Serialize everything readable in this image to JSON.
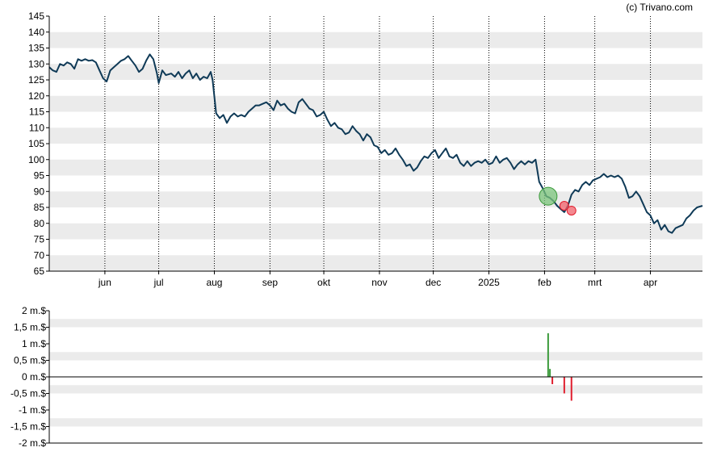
{
  "credit": "(c) Trivano.com",
  "colors": {
    "line": "#0f3a57",
    "band": "#ebebeb",
    "buy": "#3a9a3a",
    "sell": "#e01e2e",
    "buy_fill": "#7bc47b",
    "sell_fill": "#f0606a"
  },
  "chart_data": [
    {
      "type": "line",
      "name": "price",
      "ylim": [
        65,
        145
      ],
      "y_ticks": [
        65,
        70,
        75,
        80,
        85,
        90,
        95,
        100,
        105,
        110,
        115,
        120,
        125,
        130,
        135,
        140,
        145
      ],
      "grid": "alternating horizontal bands, dotted vertical month lines",
      "x_domain": [
        "2024-05-01",
        "2025-04-30"
      ],
      "x_ticks": [
        {
          "label": "jun",
          "date": "2024-06-01"
        },
        {
          "label": "jul",
          "date": "2024-07-01"
        },
        {
          "label": "aug",
          "date": "2024-08-01"
        },
        {
          "label": "sep",
          "date": "2024-09-01"
        },
        {
          "label": "okt",
          "date": "2024-10-01"
        },
        {
          "label": "nov",
          "date": "2024-11-01"
        },
        {
          "label": "dec",
          "date": "2024-12-01"
        },
        {
          "label": "2025",
          "date": "2025-01-01"
        },
        {
          "label": "feb",
          "date": "2025-02-01"
        },
        {
          "label": "mrt",
          "date": "2025-03-01"
        },
        {
          "label": "apr",
          "date": "2025-04-01"
        }
      ],
      "series": [
        {
          "points": [
            [
              "2024-05-01",
              129
            ],
            [
              "2024-05-03",
              128
            ],
            [
              "2024-05-05",
              127.5
            ],
            [
              "2024-05-07",
              130
            ],
            [
              "2024-05-09",
              129.5
            ],
            [
              "2024-05-11",
              130.5
            ],
            [
              "2024-05-13",
              130
            ],
            [
              "2024-05-15",
              128.5
            ],
            [
              "2024-05-17",
              131.5
            ],
            [
              "2024-05-19",
              131
            ],
            [
              "2024-05-21",
              131.5
            ],
            [
              "2024-05-23",
              131
            ],
            [
              "2024-05-25",
              131.2
            ],
            [
              "2024-05-27",
              130.5
            ],
            [
              "2024-05-29",
              128
            ],
            [
              "2024-05-31",
              125.5
            ],
            [
              "2024-06-02",
              124.5
            ],
            [
              "2024-06-04",
              128
            ],
            [
              "2024-06-06",
              129
            ],
            [
              "2024-06-08",
              130
            ],
            [
              "2024-06-10",
              131
            ],
            [
              "2024-06-12",
              131.5
            ],
            [
              "2024-06-14",
              132.5
            ],
            [
              "2024-06-16",
              131
            ],
            [
              "2024-06-18",
              129.5
            ],
            [
              "2024-06-20",
              127.5
            ],
            [
              "2024-06-22",
              128.5
            ],
            [
              "2024-06-24",
              131
            ],
            [
              "2024-06-26",
              133
            ],
            [
              "2024-06-28",
              131.5
            ],
            [
              "2024-06-30",
              127
            ],
            [
              "2024-07-01",
              124
            ],
            [
              "2024-07-03",
              128
            ],
            [
              "2024-07-05",
              126.5
            ],
            [
              "2024-07-08",
              127
            ],
            [
              "2024-07-10",
              126
            ],
            [
              "2024-07-12",
              127.5
            ],
            [
              "2024-07-14",
              125.5
            ],
            [
              "2024-07-16",
              127
            ],
            [
              "2024-07-18",
              128
            ],
            [
              "2024-07-20",
              125.5
            ],
            [
              "2024-07-22",
              127
            ],
            [
              "2024-07-24",
              125
            ],
            [
              "2024-07-26",
              126
            ],
            [
              "2024-07-28",
              125.5
            ],
            [
              "2024-07-30",
              127.5
            ],
            [
              "2024-07-31",
              125
            ],
            [
              "2024-08-02",
              114.5
            ],
            [
              "2024-08-04",
              113
            ],
            [
              "2024-08-06",
              114
            ],
            [
              "2024-08-08",
              111.5
            ],
            [
              "2024-08-10",
              113.5
            ],
            [
              "2024-08-12",
              114.5
            ],
            [
              "2024-08-14",
              113.5
            ],
            [
              "2024-08-16",
              114
            ],
            [
              "2024-08-18",
              113.5
            ],
            [
              "2024-08-20",
              115
            ],
            [
              "2024-08-22",
              116
            ],
            [
              "2024-08-24",
              117
            ],
            [
              "2024-08-26",
              117
            ],
            [
              "2024-08-28",
              117.5
            ],
            [
              "2024-08-30",
              118
            ],
            [
              "2024-09-01",
              117
            ],
            [
              "2024-09-03",
              115.5
            ],
            [
              "2024-09-05",
              118.5
            ],
            [
              "2024-09-07",
              117
            ],
            [
              "2024-09-09",
              117.5
            ],
            [
              "2024-09-11",
              116
            ],
            [
              "2024-09-13",
              115
            ],
            [
              "2024-09-15",
              114.5
            ],
            [
              "2024-09-17",
              118
            ],
            [
              "2024-09-19",
              119
            ],
            [
              "2024-09-21",
              117.5
            ],
            [
              "2024-09-23",
              116
            ],
            [
              "2024-09-25",
              115.5
            ],
            [
              "2024-09-27",
              113.5
            ],
            [
              "2024-09-29",
              114
            ],
            [
              "2024-10-01",
              115
            ],
            [
              "2024-10-03",
              112.5
            ],
            [
              "2024-10-05",
              110.5
            ],
            [
              "2024-10-07",
              111.5
            ],
            [
              "2024-10-09",
              110
            ],
            [
              "2024-10-11",
              109.5
            ],
            [
              "2024-10-13",
              108
            ],
            [
              "2024-10-15",
              108.5
            ],
            [
              "2024-10-17",
              110.5
            ],
            [
              "2024-10-19",
              109
            ],
            [
              "2024-10-21",
              108
            ],
            [
              "2024-10-23",
              106
            ],
            [
              "2024-10-25",
              108
            ],
            [
              "2024-10-27",
              107
            ],
            [
              "2024-10-29",
              104.5
            ],
            [
              "2024-10-31",
              104
            ],
            [
              "2024-11-02",
              102
            ],
            [
              "2024-11-04",
              103
            ],
            [
              "2024-11-06",
              101.5
            ],
            [
              "2024-11-08",
              102
            ],
            [
              "2024-11-10",
              103.5
            ],
            [
              "2024-11-12",
              101.5
            ],
            [
              "2024-11-14",
              100
            ],
            [
              "2024-11-16",
              98
            ],
            [
              "2024-11-18",
              98.5
            ],
            [
              "2024-11-20",
              96.5
            ],
            [
              "2024-11-22",
              97.5
            ],
            [
              "2024-11-24",
              99.5
            ],
            [
              "2024-11-26",
              101
            ],
            [
              "2024-11-28",
              100.5
            ],
            [
              "2024-11-30",
              102
            ],
            [
              "2024-12-02",
              103
            ],
            [
              "2024-12-04",
              100.5
            ],
            [
              "2024-12-06",
              102
            ],
            [
              "2024-12-08",
              103.5
            ],
            [
              "2024-12-10",
              101
            ],
            [
              "2024-12-12",
              100.5
            ],
            [
              "2024-12-14",
              101.5
            ],
            [
              "2024-12-16",
              99
            ],
            [
              "2024-12-18",
              98
            ],
            [
              "2024-12-20",
              99.5
            ],
            [
              "2024-12-22",
              98
            ],
            [
              "2024-12-24",
              99
            ],
            [
              "2024-12-26",
              99.5
            ],
            [
              "2024-12-28",
              99
            ],
            [
              "2024-12-30",
              100
            ],
            [
              "2025-01-01",
              98.5
            ],
            [
              "2025-01-03",
              99
            ],
            [
              "2025-01-05",
              101
            ],
            [
              "2025-01-07",
              99
            ],
            [
              "2025-01-09",
              100
            ],
            [
              "2025-01-11",
              100.5
            ],
            [
              "2025-01-13",
              99
            ],
            [
              "2025-01-15",
              97
            ],
            [
              "2025-01-17",
              98.5
            ],
            [
              "2025-01-19",
              99.5
            ],
            [
              "2025-01-21",
              98.5
            ],
            [
              "2025-01-23",
              99.5
            ],
            [
              "2025-01-25",
              99
            ],
            [
              "2025-01-27",
              100
            ],
            [
              "2025-01-29",
              93
            ],
            [
              "2025-01-31",
              91
            ],
            [
              "2025-02-02",
              88.5
            ],
            [
              "2025-02-04",
              88
            ],
            [
              "2025-02-06",
              87
            ],
            [
              "2025-02-08",
              85.5
            ],
            [
              "2025-02-10",
              84.5
            ],
            [
              "2025-02-12",
              83.5
            ],
            [
              "2025-02-14",
              85.5
            ],
            [
              "2025-02-16",
              89
            ],
            [
              "2025-02-18",
              90.5
            ],
            [
              "2025-02-20",
              90
            ],
            [
              "2025-02-22",
              92
            ],
            [
              "2025-02-24",
              93
            ],
            [
              "2025-02-26",
              92
            ],
            [
              "2025-02-28",
              93.5
            ],
            [
              "2025-03-02",
              94
            ],
            [
              "2025-03-04",
              94.5
            ],
            [
              "2025-03-06",
              95.5
            ],
            [
              "2025-03-08",
              94.5
            ],
            [
              "2025-03-10",
              95
            ],
            [
              "2025-03-12",
              94.5
            ],
            [
              "2025-03-14",
              95
            ],
            [
              "2025-03-16",
              94
            ],
            [
              "2025-03-18",
              91.5
            ],
            [
              "2025-03-20",
              88
            ],
            [
              "2025-03-22",
              88.5
            ],
            [
              "2025-03-24",
              90
            ],
            [
              "2025-03-26",
              88.5
            ],
            [
              "2025-03-28",
              86
            ],
            [
              "2025-03-30",
              83.5
            ],
            [
              "2025-04-01",
              82.5
            ],
            [
              "2025-04-03",
              80
            ],
            [
              "2025-04-05",
              81
            ],
            [
              "2025-04-07",
              78
            ],
            [
              "2025-04-09",
              79.5
            ],
            [
              "2025-04-11",
              77.5
            ],
            [
              "2025-04-13",
              77
            ],
            [
              "2025-04-15",
              78.5
            ],
            [
              "2025-04-17",
              79
            ],
            [
              "2025-04-19",
              79.5
            ],
            [
              "2025-04-21",
              81.5
            ],
            [
              "2025-04-23",
              82.5
            ],
            [
              "2025-04-25",
              84
            ],
            [
              "2025-04-27",
              85
            ],
            [
              "2025-04-30",
              85.5
            ]
          ]
        }
      ],
      "markers": [
        {
          "kind": "buy",
          "date": "2025-02-03",
          "y": 88.5,
          "size": "large"
        },
        {
          "kind": "sell",
          "date": "2025-02-12",
          "y": 85.5,
          "size": "small"
        },
        {
          "kind": "sell",
          "date": "2025-02-16",
          "y": 84,
          "size": "small"
        }
      ]
    },
    {
      "type": "bar",
      "name": "transactions",
      "ylim": [
        -2,
        2
      ],
      "y_ticks": [
        {
          "value": 2,
          "label": "2 m.$"
        },
        {
          "value": 1.5,
          "label": "1,5 m.$"
        },
        {
          "value": 1,
          "label": "1 m.$"
        },
        {
          "value": 0.5,
          "label": "0,5 m.$"
        },
        {
          "value": 0,
          "label": "0 m.$"
        },
        {
          "value": -0.5,
          "label": "-0,5 m.$"
        },
        {
          "value": -1,
          "label": "-1 m.$"
        },
        {
          "value": -1.5,
          "label": "-1,5 m.$"
        },
        {
          "value": -2,
          "label": "-2 m.$"
        }
      ],
      "bars": [
        {
          "date": "2025-02-03",
          "value": 1.32,
          "kind": "buy"
        },
        {
          "date": "2025-02-04",
          "value": 0.24,
          "kind": "buy"
        },
        {
          "date": "2025-02-04",
          "value": -0.22,
          "kind": "sell"
        },
        {
          "date": "2025-02-12",
          "value": -0.5,
          "kind": "sell"
        },
        {
          "date": "2025-02-16",
          "value": -0.72,
          "kind": "sell"
        }
      ]
    }
  ]
}
